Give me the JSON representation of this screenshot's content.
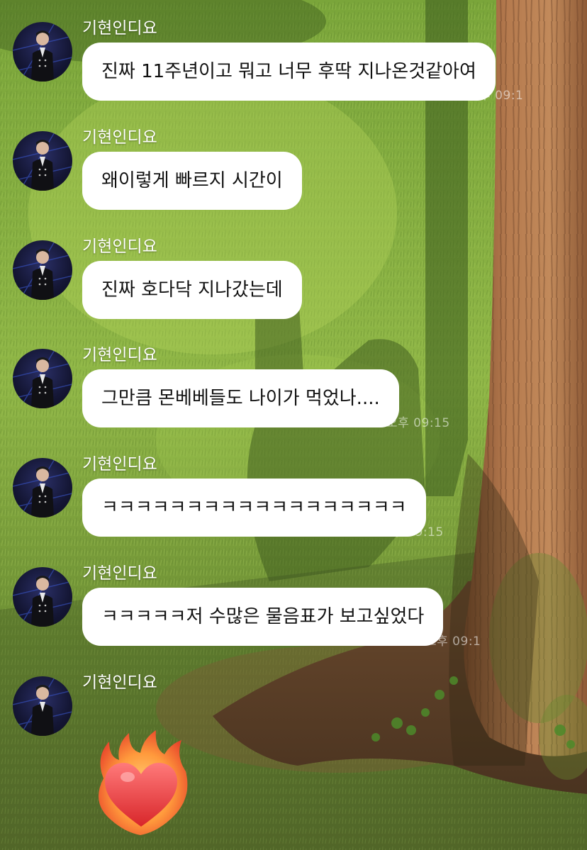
{
  "chat": {
    "sender_name": "기현인디요",
    "messages": [
      {
        "text": "진짜 11주년이고 뭐고 너무 후딱 지나온것같아여",
        "time": "오후 09:1"
      },
      {
        "text": "왜이렇게 빠르지 시간이",
        "time": ""
      },
      {
        "text": "진짜 호다닥 지나갔는데",
        "time": ""
      },
      {
        "text": "그만큼 몬베베들도 나이가 먹었나....",
        "time": "오후 09:15"
      },
      {
        "text": "ㅋㅋㅋㅋㅋㅋㅋㅋㅋㅋㅋㅋㅋㅋㅋㅋㅋㅋ",
        "time": "오후 09:15"
      },
      {
        "text": "ㅋㅋㅋㅋㅋ저 수많은 물음표가 보고싶었다",
        "time": "오후 09:1"
      }
    ],
    "last_message": {
      "type": "emoji",
      "icon": "heart-on-fire-icon"
    }
  },
  "colors": {
    "bubble": "#ffffff",
    "sender_text": "#ffffff",
    "message_text": "#111111"
  }
}
